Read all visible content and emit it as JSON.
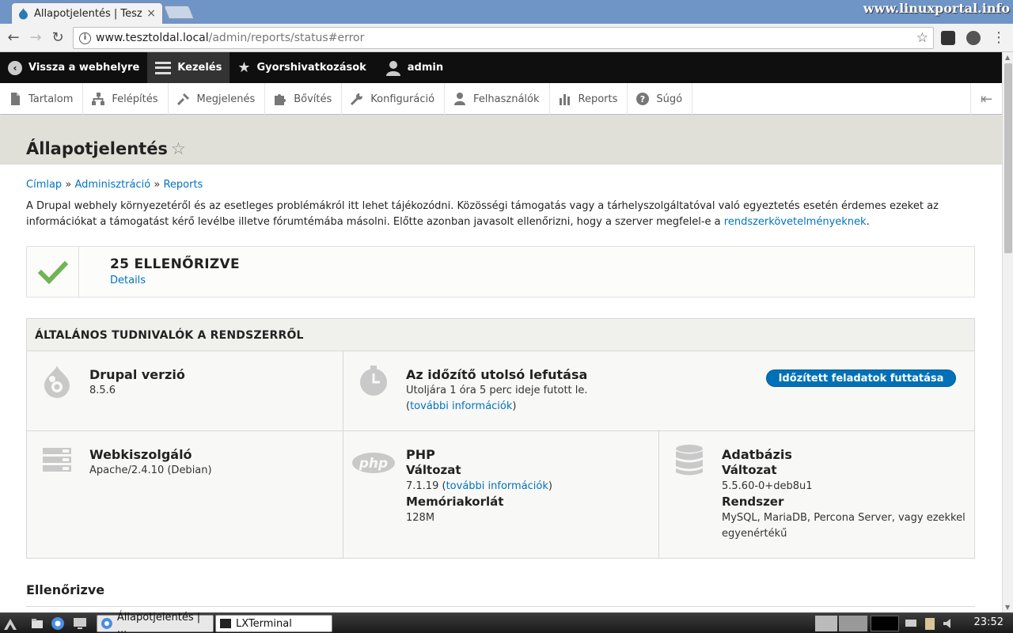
{
  "browser": {
    "tab_title": "Állapotjelentés | Tesz",
    "tab_close": "×",
    "url_host": "www.tesztoldal.local",
    "url_path": "/admin/reports/status#error",
    "watermark": "www.linuxportal.info"
  },
  "admin_bar": {
    "back": "Vissza a webhelyre",
    "manage": "Kezelés",
    "shortcuts": "Gyorshivatkozások",
    "user": "admin"
  },
  "tray": {
    "items": [
      {
        "label": "Tartalom",
        "icon": "document-icon"
      },
      {
        "label": "Felépítés",
        "icon": "sitemap-icon"
      },
      {
        "label": "Megjelenés",
        "icon": "paintbrush-icon"
      },
      {
        "label": "Bővítés",
        "icon": "puzzle-icon"
      },
      {
        "label": "Konfiguráció",
        "icon": "wrench-icon"
      },
      {
        "label": "Felhasználók",
        "icon": "people-icon"
      },
      {
        "label": "Reports",
        "icon": "bar-chart-icon"
      },
      {
        "label": "Súgó",
        "icon": "help-icon"
      }
    ]
  },
  "page": {
    "title": "Állapotjelentés",
    "breadcrumb": [
      "Címlap",
      "Adminisztráció",
      "Reports"
    ],
    "breadcrumb_sep": "»",
    "intro_text": "A Drupal webhely környezetéről és az esetleges problémákról itt lehet tájékozódni. Közösségi támogatás vagy a tárhelyszolgáltatóval való egyeztetés esetén érdemes ezeket az információkat a támogatást kérő levélbe illetve fórumtémába másolni. Előtte azonban javasolt ellenőrizni, hogy a szerver megfelel-e a ",
    "intro_link": "rendszerkövetelményeknek",
    "intro_end": "."
  },
  "checked": {
    "count_label": "25 ELLENŐRIZVE",
    "details": "Details"
  },
  "sysinfo": {
    "title": "ÁLTALÁNOS TUDNIVALÓK A RENDSZERRŐL",
    "drupal": {
      "title": "Drupal verzió",
      "value": "8.5.6"
    },
    "cron": {
      "title": "Az időzítő utolsó lefutása",
      "text": "Utoljára 1 óra 5 perc ideje futott le.",
      "link": "további információk",
      "button": "Időzített feladatok futtatása"
    },
    "webserver": {
      "title": "Webkiszolgáló",
      "value": "Apache/2.4.10 (Debian)"
    },
    "php": {
      "title": "PHP",
      "version_label": "Változat",
      "version": "7.1.19",
      "version_link": "további információk",
      "memory_label": "Memóriakorlát",
      "memory": "128M"
    },
    "database": {
      "title": "Adatbázis",
      "version_label": "Változat",
      "version": "5.5.60-0+deb8u1",
      "system_label": "Rendszer",
      "system": "MySQL, MariaDB, Percona Server, vagy ezekkel egyenértékű"
    }
  },
  "section_checked": "Ellenőrizve",
  "taskbar": {
    "task1": "Állapotjelentés | ...",
    "task2": "LXTerminal",
    "clock": "23:52"
  }
}
